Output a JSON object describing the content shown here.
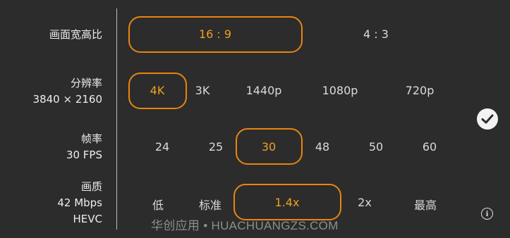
{
  "rows": [
    {
      "title": "画面宽高比",
      "subtitle": "",
      "options": [
        "16 : 9",
        "4 : 3"
      ],
      "selected": 0
    },
    {
      "title": "分辨率",
      "subtitle": "3840 × 2160",
      "options": [
        "4K",
        "3K",
        "1440p",
        "1080p",
        "720p"
      ],
      "selected": 0
    },
    {
      "title": "帧率",
      "subtitle": "30 FPS",
      "options": [
        "24",
        "25",
        "30",
        "48",
        "50",
        "60"
      ],
      "selected": 2
    },
    {
      "title": "画质",
      "subtitle": "42 Mbps",
      "subtitle2": "HEVC",
      "options": [
        "低",
        "标准",
        "1.4x",
        "2x",
        "最高"
      ],
      "selected": 2
    }
  ],
  "icons": {
    "confirm": "checkmark-circle-icon",
    "info": "info-icon"
  },
  "colors": {
    "accent": "#e8850f",
    "selected_text": "#f0a020",
    "background": "#2c2c2c"
  },
  "watermark": "华创应用 • HUACHUANGZS.COM"
}
